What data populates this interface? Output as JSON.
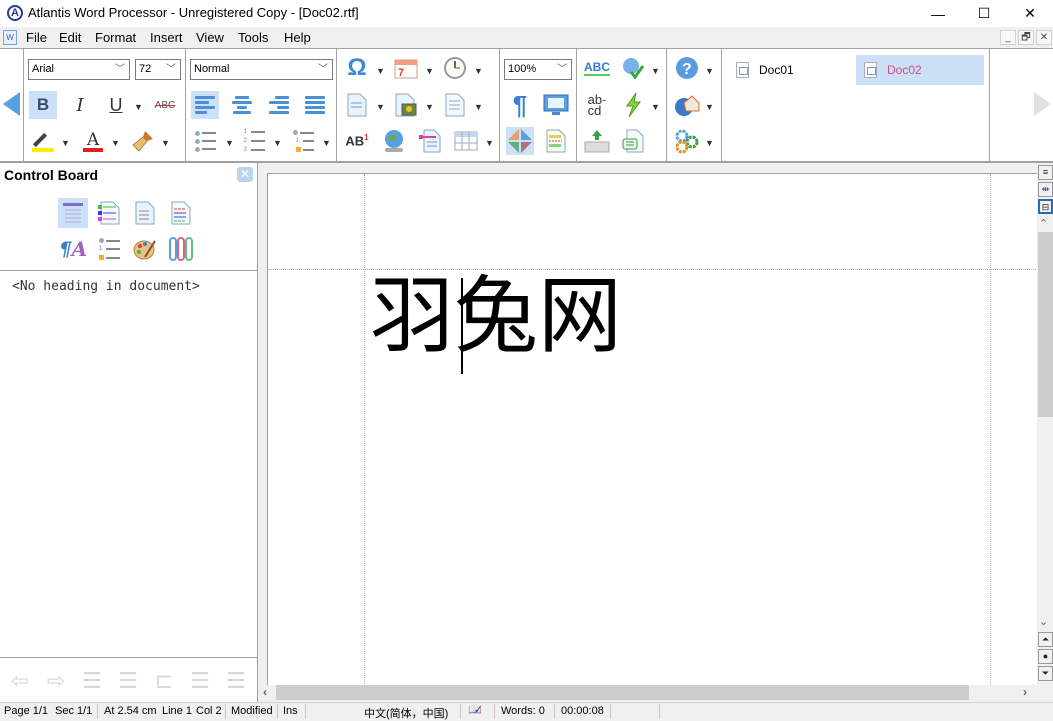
{
  "window": {
    "title": "Atlantis Word Processor - Unregistered Copy - [Doc02.rtf]",
    "app_icon": "A",
    "controls": {
      "minimize": "—",
      "maximize": "☐",
      "close": "✕"
    }
  },
  "menubar": {
    "items": [
      "File",
      "Edit",
      "Format",
      "Insert",
      "View",
      "Tools",
      "Help"
    ],
    "mdi_controls": {
      "minimize": "_",
      "restore": "🗗",
      "close": "✕"
    }
  },
  "toolbar": {
    "font_name": "Arial",
    "font_size": "72",
    "style": "Normal",
    "zoom": "100%",
    "bold_label": "B",
    "italic_label": "I",
    "underline_label": "U",
    "strikethrough_label": "ABC",
    "font_color_label": "A",
    "superscript_label": "AB",
    "superscript_num": "1",
    "hyphenation_top": "ab",
    "hyphenation_bottom": "cd",
    "spellcheck_label": "ABC",
    "symbol_label": "Ω",
    "pilcrow_label": "¶",
    "help_label": "?",
    "highlight_color": "#ffee00",
    "font_color": "#e02020"
  },
  "doc_tabs": [
    {
      "label": "Doc01",
      "active": false
    },
    {
      "label": "Doc02",
      "active": true
    }
  ],
  "control_board": {
    "title": "Control Board",
    "close_label": "✕",
    "empty_message": "<No heading in document>"
  },
  "document": {
    "text": "羽兔网"
  },
  "statusbar": {
    "page": "Page 1/1",
    "section": "Sec 1/1",
    "position": "At 2.54 cm",
    "line": "Line 1",
    "col": "Col 2",
    "modified": "Modified",
    "mode": "Ins",
    "language": "中文(简体，中国)",
    "words": "Words: 0",
    "time": "00:00:08"
  },
  "colors": {
    "accent": "#cce0f7",
    "active_tab_text": "#d0507a",
    "nav_arrow": "#5aa0e0"
  }
}
